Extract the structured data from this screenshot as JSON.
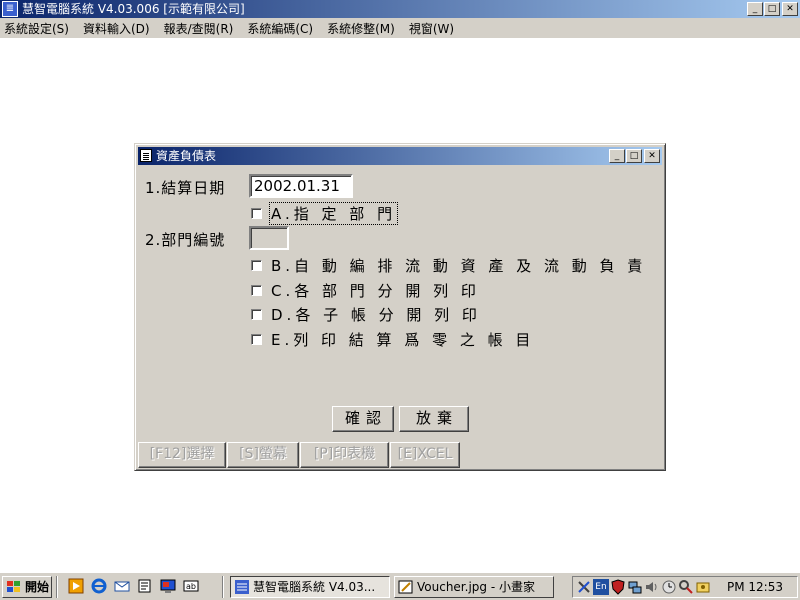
{
  "main_window": {
    "title": "慧智電腦系統 V4.03.006 [示範有限公司]",
    "icon": "app-logo-icon"
  },
  "menu": [
    {
      "label": "系統設定(S)"
    },
    {
      "label": "資料輸入(D)"
    },
    {
      "label": "報表/查閱(R)"
    },
    {
      "label": "系統編碼(C)"
    },
    {
      "label": "系統修整(M)"
    },
    {
      "label": "視窗(W)"
    }
  ],
  "dialog": {
    "title": "資產負債表",
    "settlement_date_label": "1.結算日期",
    "settlement_date_value": "2002.01.31",
    "option_a_label": "A.指 定 部 門",
    "department_no_label": "2.部門編號",
    "department_no_value": "",
    "option_b_label": "B.自 動 編 排 流 動 資 產 及 流 動 負 責",
    "option_c_label": "C.各 部 門 分 開 列 印",
    "option_d_label": "D.各 子 帳 分 開 列 印",
    "option_e_label": "E.列 印 結 算 爲 零 之 帳 目",
    "confirm_label": "確認",
    "cancel_label": "放棄",
    "bottom_buttons": {
      "f12": "[F12]選擇",
      "screen": "[S]螢幕",
      "printer": "[P]印表機",
      "excel": "[E]XCEL"
    }
  },
  "taskbar": {
    "start_label": "開始",
    "task_main": "慧智電腦系統 V4.03...",
    "task_paint": "Voucher.jpg - 小畫家",
    "tray_lang": "En",
    "clock": "PM 12:53"
  }
}
